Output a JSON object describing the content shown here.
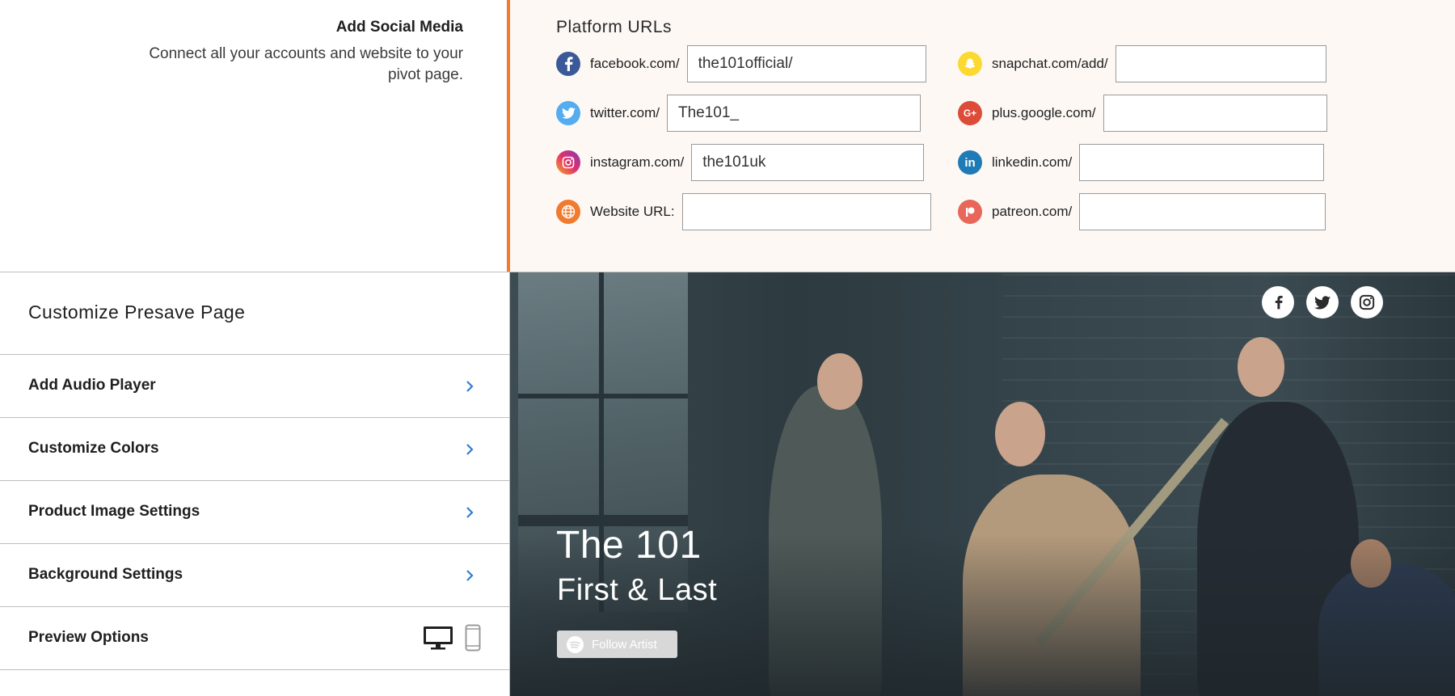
{
  "social_section": {
    "title": "Add Social Media",
    "description": "Connect all your accounts and website to your pivot page."
  },
  "platform_urls": {
    "title": "Platform URLs",
    "rows": [
      {
        "label": "facebook.com/",
        "value": "the101official/",
        "icon": "facebook-icon",
        "color": "#3b5998"
      },
      {
        "label": "twitter.com/",
        "value": "The101_",
        "icon": "twitter-icon",
        "color": "#55acee"
      },
      {
        "label": "instagram.com/",
        "value": "the101uk",
        "icon": "instagram-icon",
        "color": "#c13584"
      },
      {
        "label": "Website URL:",
        "value": "",
        "icon": "globe-icon",
        "color": "#f07a2e"
      },
      {
        "label": "snapchat.com/add/",
        "value": "",
        "icon": "snapchat-icon",
        "color": "#fffc00"
      },
      {
        "label": "plus.google.com/",
        "value": "",
        "icon": "google-plus-icon",
        "color": "#dd4b39"
      },
      {
        "label": "linkedin.com/",
        "value": "",
        "icon": "linkedin-icon",
        "color": "#0077b5"
      },
      {
        "label": "patreon.com/",
        "value": "",
        "icon": "patreon-icon",
        "color": "#f96854"
      }
    ]
  },
  "customize": {
    "title": "Customize Presave Page",
    "items": [
      {
        "label": "Add Audio Player"
      },
      {
        "label": "Customize Colors"
      },
      {
        "label": "Product Image Settings"
      },
      {
        "label": "Background Settings"
      },
      {
        "label": "Preview Options"
      }
    ]
  },
  "preview": {
    "artist": "The 101",
    "song": "First & Last",
    "follow_label": "Follow Artist",
    "social_icons": [
      "facebook-icon",
      "twitter-icon",
      "instagram-icon"
    ]
  },
  "colors": {
    "accent": "#f07a2e",
    "chevron": "#2f7fd1"
  }
}
